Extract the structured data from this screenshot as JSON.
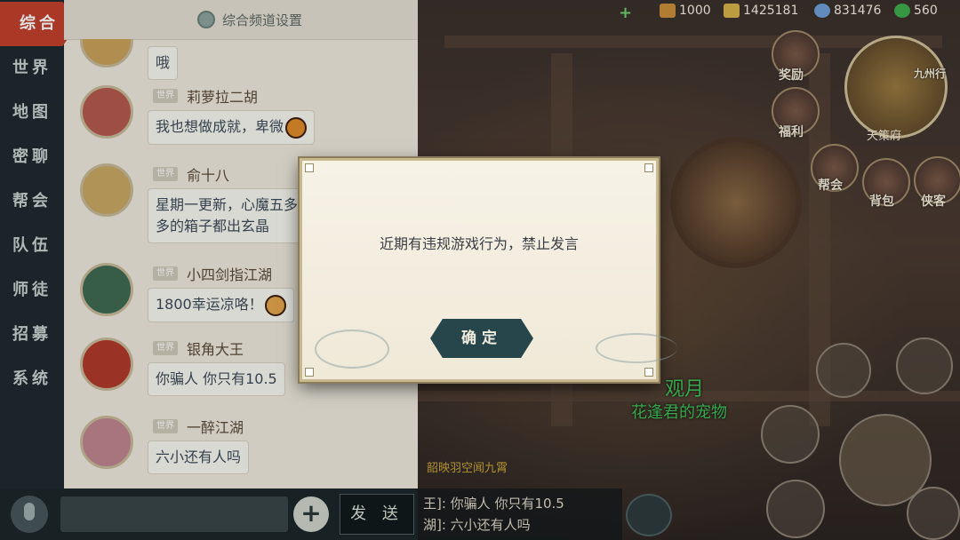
{
  "channels": [
    {
      "label": "综合",
      "active": true
    },
    {
      "label": "世界"
    },
    {
      "label": "地图"
    },
    {
      "label": "密聊"
    },
    {
      "label": "帮会"
    },
    {
      "label": "队伍"
    },
    {
      "label": "师徒"
    },
    {
      "label": "招募"
    },
    {
      "label": "系统"
    }
  ],
  "settings": {
    "label": "综合频道设置"
  },
  "messages": [
    {
      "tag": "世界",
      "name": "",
      "text": "哦"
    },
    {
      "tag": "世界",
      "name": "莉萝拉二胡",
      "text": "我也想做成就，卑微"
    },
    {
      "tag": "世界",
      "name": "俞十八",
      "text": "星期一更新，心魔五多\n多的箱子都出玄晶"
    },
    {
      "tag": "世界",
      "name": "小四剑指江湖",
      "text": "1800幸运凉咯！"
    },
    {
      "tag": "世界",
      "name": "银角大王",
      "text": "你骗人   你只有10.5"
    },
    {
      "tag": "世界",
      "name": "一醉江湖",
      "text": "六小还有人吗"
    }
  ],
  "input": {
    "placeholder": "",
    "send_label": "发 送",
    "plus": "+"
  },
  "resources": [
    {
      "icon": "plus-icon",
      "value": ""
    },
    {
      "icon": "ingot-icon",
      "value": "1000"
    },
    {
      "icon": "gold-icon",
      "value": "1425181"
    },
    {
      "icon": "silver-icon",
      "value": "831476"
    },
    {
      "icon": "clover-icon",
      "value": "560"
    }
  ],
  "side_menu": [
    {
      "label": "奖励",
      "icon": "reward-icon"
    },
    {
      "label": "福利",
      "icon": "welfare-icon"
    },
    {
      "label": "帮会",
      "icon": "guild-icon"
    },
    {
      "label": "背包",
      "icon": "bag-icon"
    },
    {
      "label": "侠客",
      "icon": "hero-icon"
    },
    {
      "label": "九州行",
      "icon": "journey-icon"
    }
  ],
  "minimap": {
    "label": "天策府"
  },
  "scene_text": {
    "player_name": "观月",
    "pet_title": "花逢君的宠物",
    "guild_tag": "韶映羽空闻九霄"
  },
  "world_chat": [
    {
      "text": "王]: 你骗人   你只有10.5"
    },
    {
      "text": "湖]: 六小还有人吗"
    }
  ],
  "dialog": {
    "message": "近期有违规游戏行为，禁止发言",
    "confirm_label": "确定"
  },
  "colors": {
    "active_channel": "#c2402d",
    "panel_bg": "#ede9dc",
    "sidebar_bg": "#1f2a2e",
    "confirm_bg": "#27464c",
    "name_green": "#3fbf58"
  }
}
